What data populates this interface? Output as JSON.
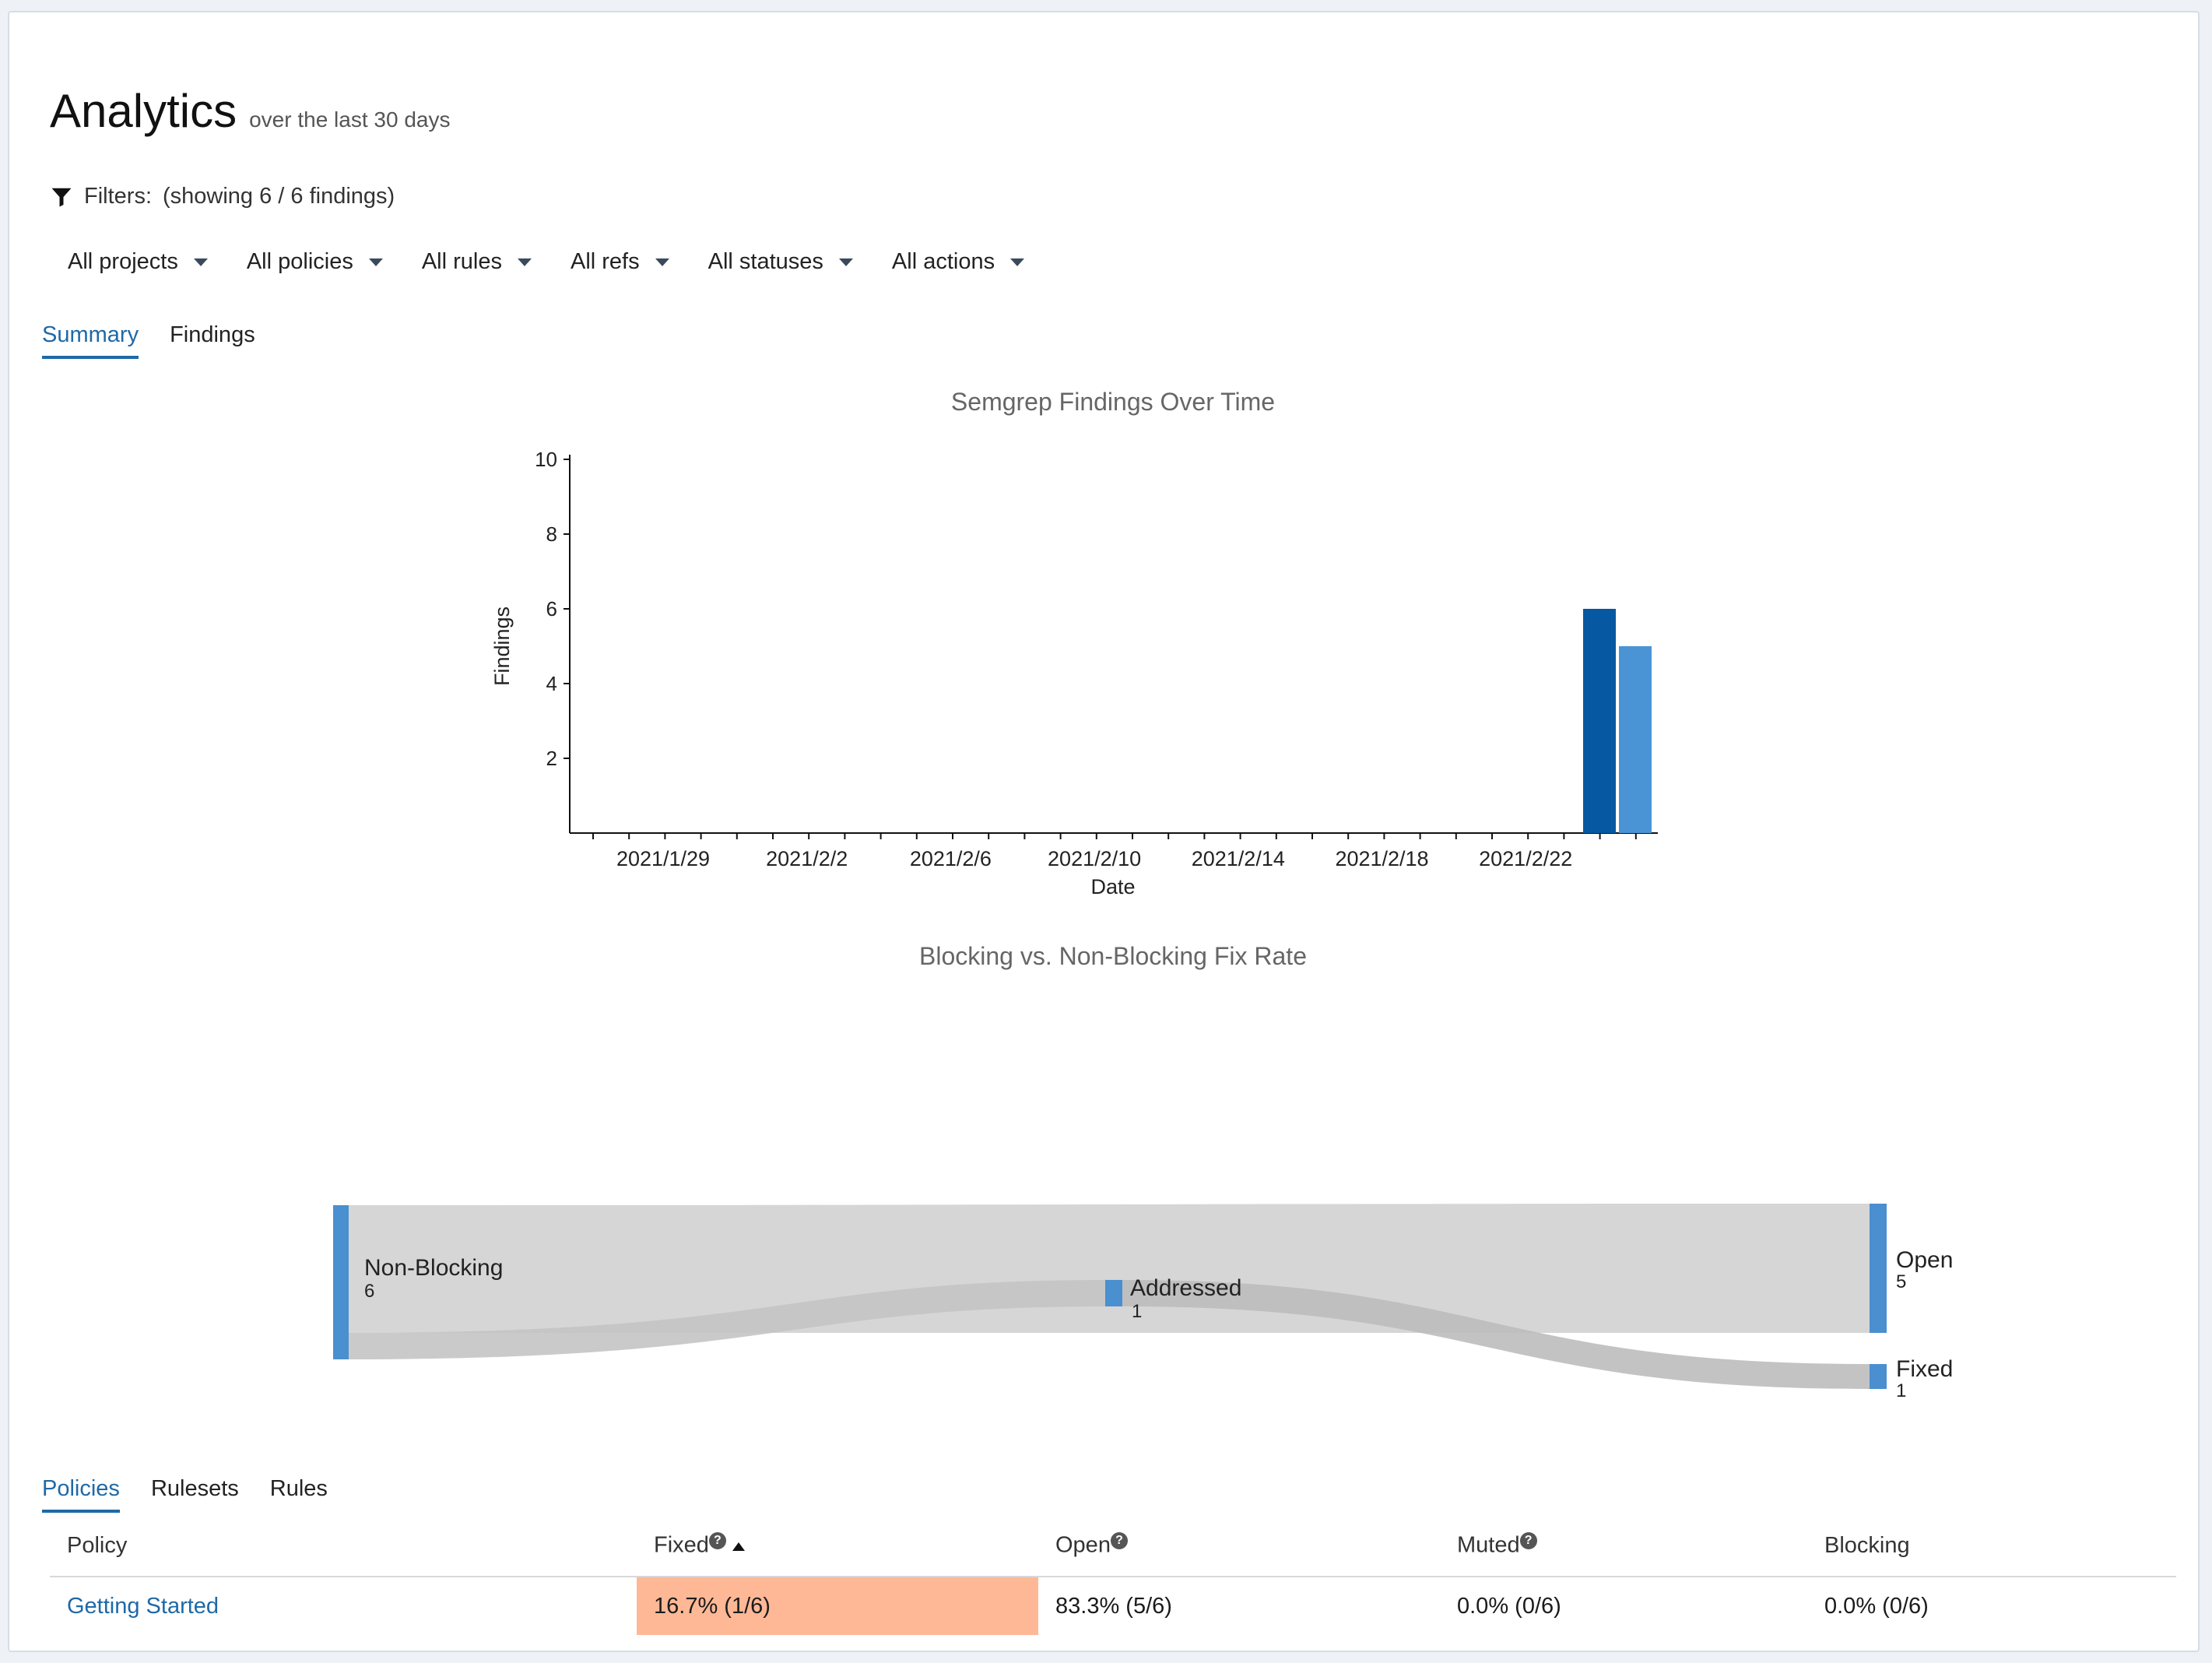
{
  "header": {
    "title": "Analytics",
    "subtitle": "over the last 30 days"
  },
  "filters": {
    "label": "Filters:",
    "count_text": "(showing 6 / 6 findings)",
    "dropdowns": [
      "All projects",
      "All policies",
      "All rules",
      "All refs",
      "All statuses",
      "All actions"
    ]
  },
  "main_tabs": [
    {
      "label": "Summary",
      "active": true
    },
    {
      "label": "Findings",
      "active": false
    }
  ],
  "findings_chart": {
    "title": "Semgrep Findings Over Time",
    "ylabel": "Findings",
    "xlabel": "Date"
  },
  "chart_data": [
    {
      "type": "bar",
      "title": "Semgrep Findings Over Time",
      "xlabel": "Date",
      "ylabel": "Findings",
      "ylim": [
        0,
        10
      ],
      "y_ticks": [
        2,
        4,
        6,
        8,
        10
      ],
      "x_ticks": [
        "2021/1/29",
        "2021/2/2",
        "2021/2/6",
        "2021/2/10",
        "2021/2/14",
        "2021/2/18",
        "2021/2/22"
      ],
      "grid": false,
      "bars": [
        {
          "x": "2021/2/24",
          "value": 6,
          "color": "#0758a3"
        },
        {
          "x": "2021/2/25",
          "value": 5,
          "color": "#4a94d6"
        }
      ]
    }
  ],
  "sankey": {
    "title": "Blocking vs. Non-Blocking Fix Rate",
    "nodes": [
      {
        "name": "Non-Blocking",
        "value": "6"
      },
      {
        "name": "Addressed",
        "value": "1"
      },
      {
        "name": "Open",
        "value": "5"
      },
      {
        "name": "Fixed",
        "value": "1"
      }
    ],
    "node_color": "#4a8fd0",
    "link_color": "#d4d4d4"
  },
  "bottom_tabs": [
    {
      "label": "Policies",
      "active": true
    },
    {
      "label": "Rulesets",
      "active": false
    },
    {
      "label": "Rules",
      "active": false
    }
  ],
  "table": {
    "headers": {
      "policy": "Policy",
      "fixed": "Fixed",
      "open": "Open",
      "muted": "Muted",
      "blocking": "Blocking"
    },
    "rows": [
      {
        "policy": "Getting Started",
        "fixed": "16.7% (1/6)",
        "open": "83.3% (5/6)",
        "muted": "0.0% (0/6)",
        "blocking": "0.0% (0/6)"
      }
    ],
    "highlight_color": "#ffb896"
  }
}
